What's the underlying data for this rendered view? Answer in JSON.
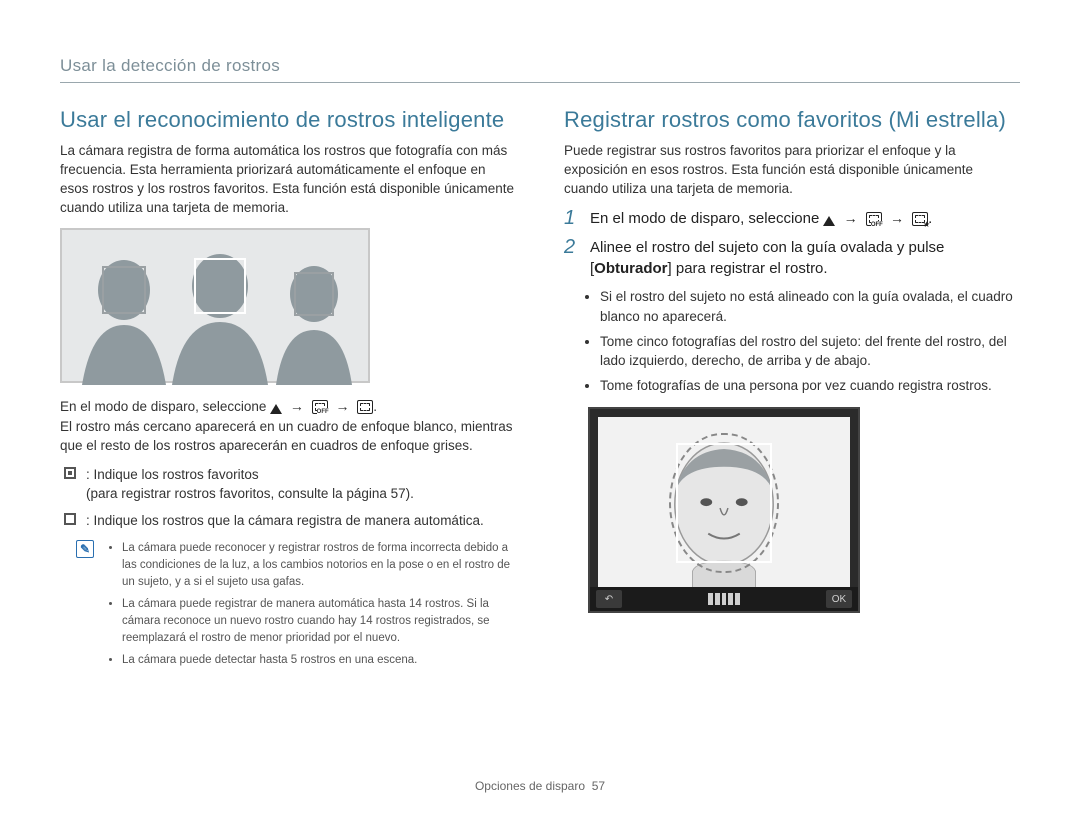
{
  "breadcrumb": "Usar la detección de rostros",
  "left": {
    "heading": "Usar el reconocimiento de rostros inteligente",
    "intro": "La cámara registra de forma automática los rostros que fotografía con más frecuencia. Esta herramienta priorizará automáticamente el enfoque en esos rostros y los rostros favoritos. Esta función está disponible únicamente cuando utiliza una tarjeta de memoria.",
    "after_image_1": "En el modo de disparo, seleccione ",
    "after_image_2": "El rostro más cercano aparecerá en un cuadro de enfoque blanco, mientras que el resto de los rostros aparecerán en cuadros de enfoque grises.",
    "fav_bullets": [
      {
        "text": ": Indique los rostros favoritos",
        "sub": "(para registrar rostros favoritos, consulte la página 57)."
      },
      {
        "text": ": Indique los rostros que la cámara registra de manera automática."
      }
    ],
    "note": [
      "La cámara puede reconocer y registrar rostros de forma incorrecta debido a las condiciones de la luz, a los cambios notorios en la pose o en el rostro de un sujeto, y a si el sujeto usa gafas.",
      "La cámara puede registrar de manera automática hasta 14 rostros. Si la cámara reconoce un nuevo rostro cuando hay 14 rostros registrados, se reemplazará el rostro de menor prioridad por el nuevo.",
      "La cámara puede detectar hasta 5 rostros en una escena."
    ]
  },
  "right": {
    "heading": "Registrar rostros como favoritos (Mi estrella)",
    "intro": "Puede registrar sus rostros favoritos para priorizar el enfoque y la exposición en esos rostros. Esta función está disponible únicamente cuando utiliza una tarjeta de memoria.",
    "step1": "En el modo de disparo, seleccione ",
    "step2_a": "Alinee el rostro del sujeto con la guía ovalada y pulse [",
    "step2_bold": "Obturador",
    "step2_b": "] para registrar el rostro.",
    "sub_bullets": [
      "Si el rostro del sujeto no está alineado con la guía ovalada, el cuadro blanco no aparecerá.",
      "Tome cinco fotografías del rostro del sujeto: del frente del rostro, del lado izquierdo, derecho, de arriba y de abajo.",
      "Tome fotografías de una persona por vez cuando registra rostros."
    ],
    "back_btn": "↶",
    "ok_btn": "OK"
  },
  "footer_section": "Opciones de disparo",
  "footer_page": "57"
}
